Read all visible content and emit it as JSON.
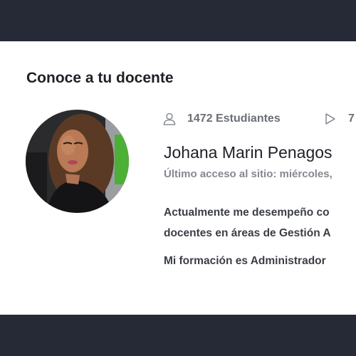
{
  "section": {
    "title": "Conoce a tu docente"
  },
  "instructor": {
    "students": "1472 Estudiantes",
    "courses": "7",
    "name": "Johana Marin Penagos",
    "last_access": "Último acceso al sitio: miércoles,",
    "bio_line1": "Actualmente me desempeño co",
    "bio_line2": "docentes en áreas de Gestión A",
    "bio_line3": "Mi formación es Administrador"
  },
  "icons": {
    "students": "user-icon",
    "courses": "play-icon"
  },
  "colors": {
    "frame": "#262a37",
    "card": "#ffffff",
    "title": "#1f2027",
    "muted": "#858891",
    "body": "#3b3e46",
    "avatar_accent": "#4caf36"
  }
}
